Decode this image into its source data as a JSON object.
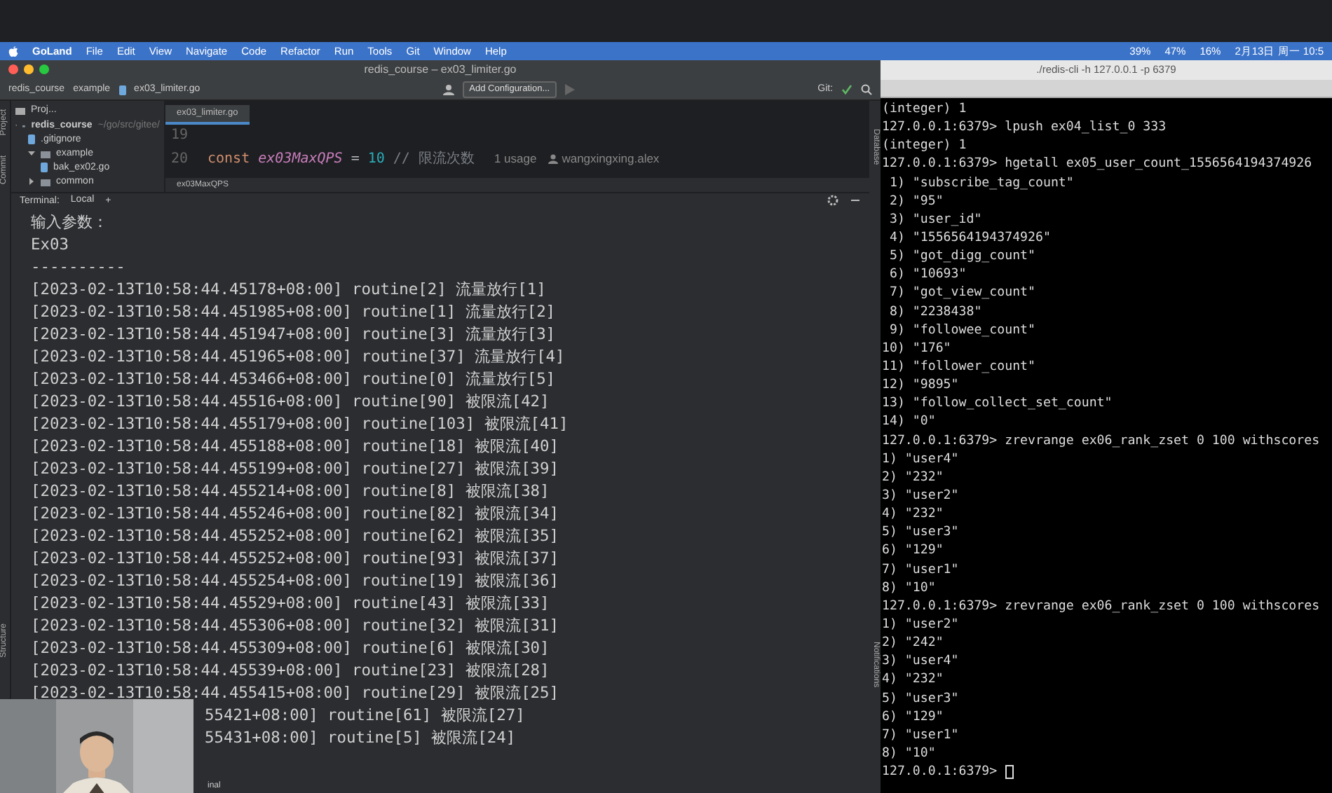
{
  "menubar": {
    "app": "GoLand",
    "items": [
      "File",
      "Edit",
      "View",
      "Navigate",
      "Code",
      "Refactor",
      "Run",
      "Tools",
      "Git",
      "Window",
      "Help"
    ],
    "status": [
      "39%",
      "47%",
      "16%",
      "2月13日 周一 10:5"
    ]
  },
  "ide": {
    "title": "redis_course – ex03_limiter.go",
    "breadcrumbs": [
      "redis_course",
      "example",
      "ex03_limiter.go"
    ],
    "run_config": "Add Configuration...",
    "git_label": "Git:",
    "tool_strip_left": [
      "Project",
      "Commit",
      "Structure"
    ],
    "tool_strip_right": [
      "Database",
      "Notifications"
    ],
    "project": {
      "title": "Proj...",
      "tree": [
        {
          "label": "redis_course",
          "hint": "~/go/src/gitee/",
          "expanded": true,
          "children": [
            {
              "label": ".gitignore"
            },
            {
              "label": "example",
              "expanded": true,
              "children": [
                {
                  "label": "bak_ex02.go"
                }
              ]
            },
            {
              "label": "common",
              "expanded": false
            }
          ]
        }
      ]
    },
    "editor": {
      "tab": "ex03_limiter.go",
      "lines": [
        {
          "number": "19"
        },
        {
          "number": "20",
          "tokens": [
            {
              "kind": "keyword",
              "text": "const"
            },
            {
              "kind": "constant",
              "text": "ex03MaxQPS"
            },
            {
              "kind": "plain",
              "text": "="
            },
            {
              "kind": "number",
              "text": "10"
            },
            {
              "kind": "comment",
              "text": "// 限流次数"
            }
          ],
          "usage": "1 usage",
          "author": "wangxingxing.alex"
        }
      ],
      "breadcrumb": "ex03MaxQPS"
    },
    "terminal": {
      "label": "Terminal:",
      "tabs": [
        {
          "label": "Local",
          "selected": true
        }
      ],
      "add": "+",
      "lines": [
        "输入参数：",
        "Ex03",
        "----------",
        "[2023-02-13T10:58:44.45178+08:00] routine[2] 流量放行[1]",
        "[2023-02-13T10:58:44.451985+08:00] routine[1] 流量放行[2]",
        "[2023-02-13T10:58:44.451947+08:00] routine[3] 流量放行[3]",
        "[2023-02-13T10:58:44.451965+08:00] routine[37] 流量放行[4]",
        "[2023-02-13T10:58:44.453466+08:00] routine[0] 流量放行[5]",
        "[2023-02-13T10:58:44.45516+08:00] routine[90] 被限流[42]",
        "[2023-02-13T10:58:44.455179+08:00] routine[103] 被限流[41]",
        "[2023-02-13T10:58:44.455188+08:00] routine[18] 被限流[40]",
        "[2023-02-13T10:58:44.455199+08:00] routine[27] 被限流[39]",
        "[2023-02-13T10:58:44.455214+08:00] routine[8] 被限流[38]",
        "[2023-02-13T10:58:44.455246+08:00] routine[82] 被限流[34]",
        "[2023-02-13T10:58:44.455252+08:00] routine[62] 被限流[35]",
        "[2023-02-13T10:58:44.455252+08:00] routine[93] 被限流[37]",
        "[2023-02-13T10:58:44.455254+08:00] routine[19] 被限流[36]",
        "[2023-02-13T10:58:44.45529+08:00] routine[43] 被限流[33]",
        "[2023-02-13T10:58:44.455306+08:00] routine[32] 被限流[31]",
        "[2023-02-13T10:58:44.455309+08:00] routine[6] 被限流[30]",
        "[2023-02-13T10:58:44.45539+08:00] routine[23] 被限流[28]"
      ],
      "covered_lines": [
        "[2023-02-13T10:58:44.455415+08:00] routine[29] 被限流[25]",
        "55421+08:00] routine[61] 被限流[27]",
        "55431+08:00] routine[5] 被限流[24]"
      ],
      "bottom_tab": "inal"
    }
  },
  "redis": {
    "title": "./redis-cli -h 127.0.0.1 -p 6379",
    "lines": [
      "(integer) 1",
      "127.0.0.1:6379> lpush ex04_list_0 333",
      "(integer) 1",
      "127.0.0.1:6379> hgetall ex05_user_count_1556564194374926",
      " 1) \"subscribe_tag_count\"",
      " 2) \"95\"",
      " 3) \"user_id\"",
      " 4) \"1556564194374926\"",
      " 5) \"got_digg_count\"",
      " 6) \"10693\"",
      " 7) \"got_view_count\"",
      " 8) \"2238438\"",
      " 9) \"followee_count\"",
      "10) \"176\"",
      "11) \"follower_count\"",
      "12) \"9895\"",
      "13) \"follow_collect_set_count\"",
      "14) \"0\"",
      "127.0.0.1:6379> zrevrange ex06_rank_zset 0 100 withscores",
      "1) \"user4\"",
      "2) \"232\"",
      "3) \"user2\"",
      "4) \"232\"",
      "5) \"user3\"",
      "6) \"129\"",
      "7) \"user1\"",
      "8) \"10\"",
      "127.0.0.1:6379> zrevrange ex06_rank_zset 0 100 withscores",
      "1) \"user2\"",
      "2) \"242\"",
      "3) \"user4\"",
      "4) \"232\"",
      "5) \"user3\"",
      "6) \"129\"",
      "7) \"user1\"",
      "8) \"10\"",
      "127.0.0.1:6379> "
    ]
  }
}
